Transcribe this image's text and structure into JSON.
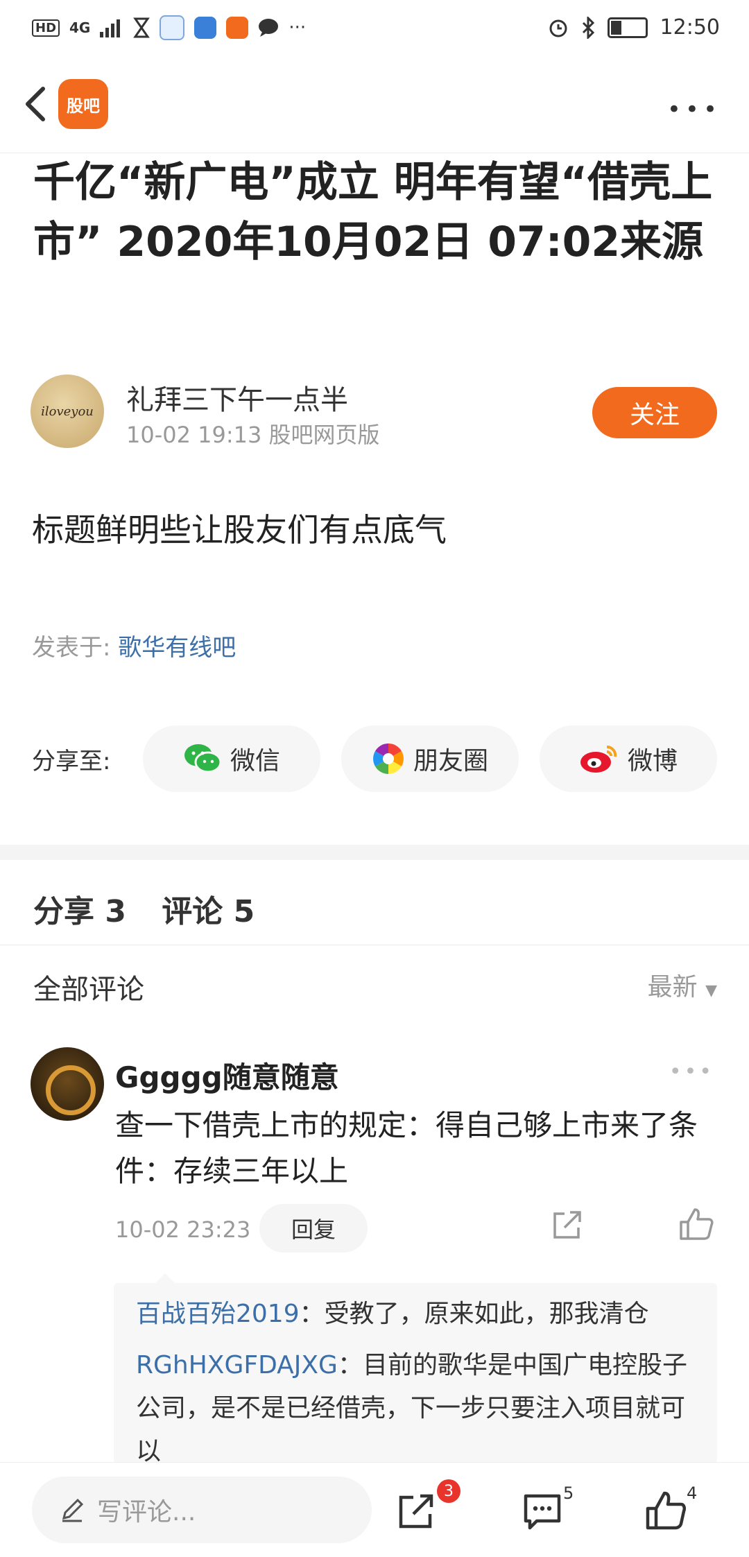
{
  "status_bar": {
    "network": "HD",
    "signal": "4G",
    "time": "12:50"
  },
  "nav": {
    "app_logo_text": "股吧",
    "more_label": "•••"
  },
  "article": {
    "title": "千亿“新广电”成立 明年有望“借壳上市” 2020年10月02日 07:02来源",
    "author_name": "礼拜三下午一点半",
    "author_meta": "10-02 19:13 股吧网页版",
    "avatar_text": "iloveyou",
    "follow_label": "关注",
    "body": "标题鲜明些让股友们有点底气",
    "posted_in_label": "发表于:",
    "posted_in_bar": "歌华有线吧"
  },
  "share": {
    "label": "分享至:",
    "wechat": "微信",
    "moments": "朋友圈",
    "weibo": "微博"
  },
  "stats": {
    "share": "分享 3",
    "comment": "评论 5"
  },
  "comments_section": {
    "title": "全部评论",
    "sort": "最新"
  },
  "comment": {
    "user": "Ggggg随意随意",
    "text": "查一下借壳上市的规定：得自己够上市来了条件：存续三年以上",
    "time": "10-02 23:23",
    "reply_label": "回复",
    "more": "•••"
  },
  "replies": [
    {
      "user": "百战百殆2019",
      "text": "：受教了，原来如此，那我清仓"
    },
    {
      "user": "RGhHXGFDAJXG",
      "text": "：目前的歌华是中国广电控股子公司，是不是已经借壳，下一步只要注入项目就可以"
    }
  ],
  "bottom_bar": {
    "write_placeholder": "写评论...",
    "share_badge": "3",
    "comment_count": "5",
    "like_count": "4"
  },
  "colors": {
    "accent": "#f26a1e",
    "link": "#3c6ea8",
    "badge": "#e8342b"
  }
}
